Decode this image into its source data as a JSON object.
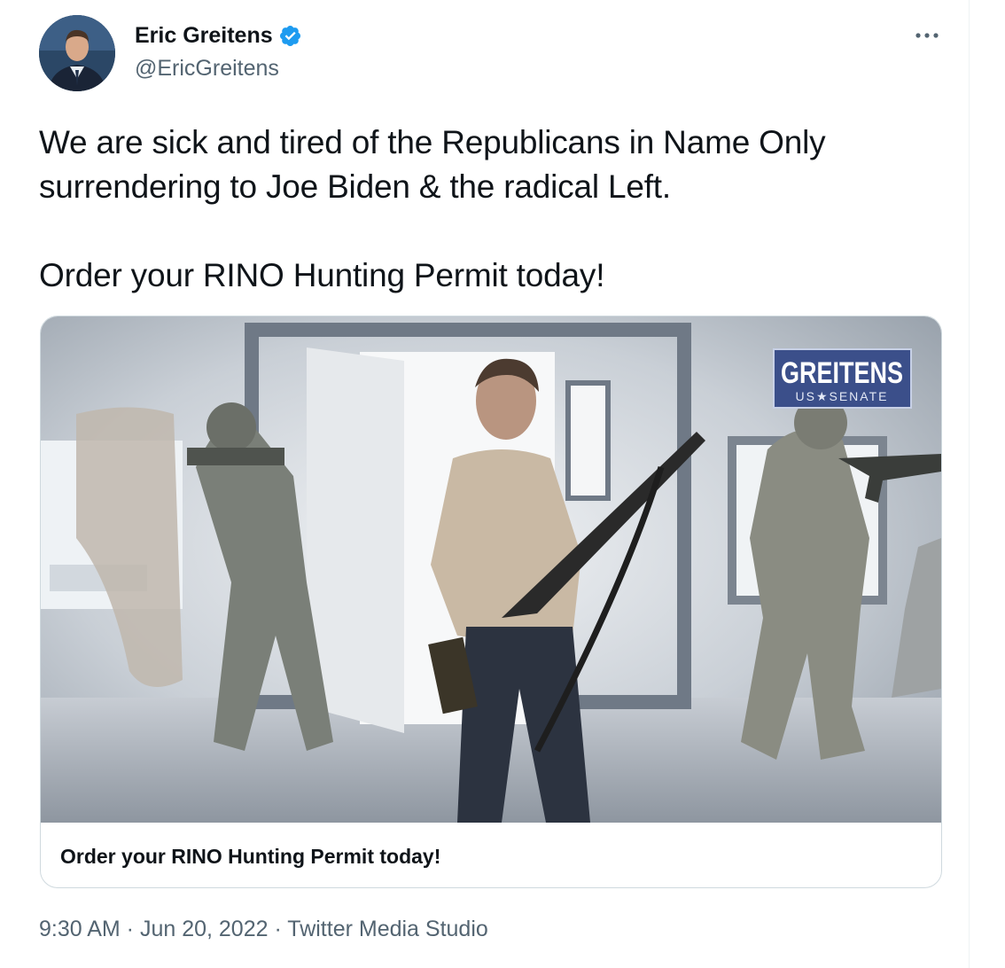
{
  "author": {
    "display_name": "Eric Greitens",
    "handle": "@EricGreitens",
    "verified": true,
    "avatar_icon": "profile-photo"
  },
  "tweet": {
    "text": "We are sick and tired of the Republicans in Name Only\nsurrendering to Joe Biden & the radical Left.\n\nOrder your RINO Hunting Permit today!"
  },
  "card": {
    "caption": "Order your RINO Hunting Permit today!",
    "logo_title": "GREITENS",
    "logo_subtitle": "US★SENATE"
  },
  "meta": {
    "time": "9:30 AM",
    "separator": " · ",
    "date": "Jun 20, 2022",
    "source": "Twitter Media Studio"
  },
  "colors": {
    "text": "#0f1419",
    "secondary": "#536471",
    "verified": "#1d9bf0",
    "border": "#cfd9de",
    "logo_bg": "#3b4f8a"
  }
}
